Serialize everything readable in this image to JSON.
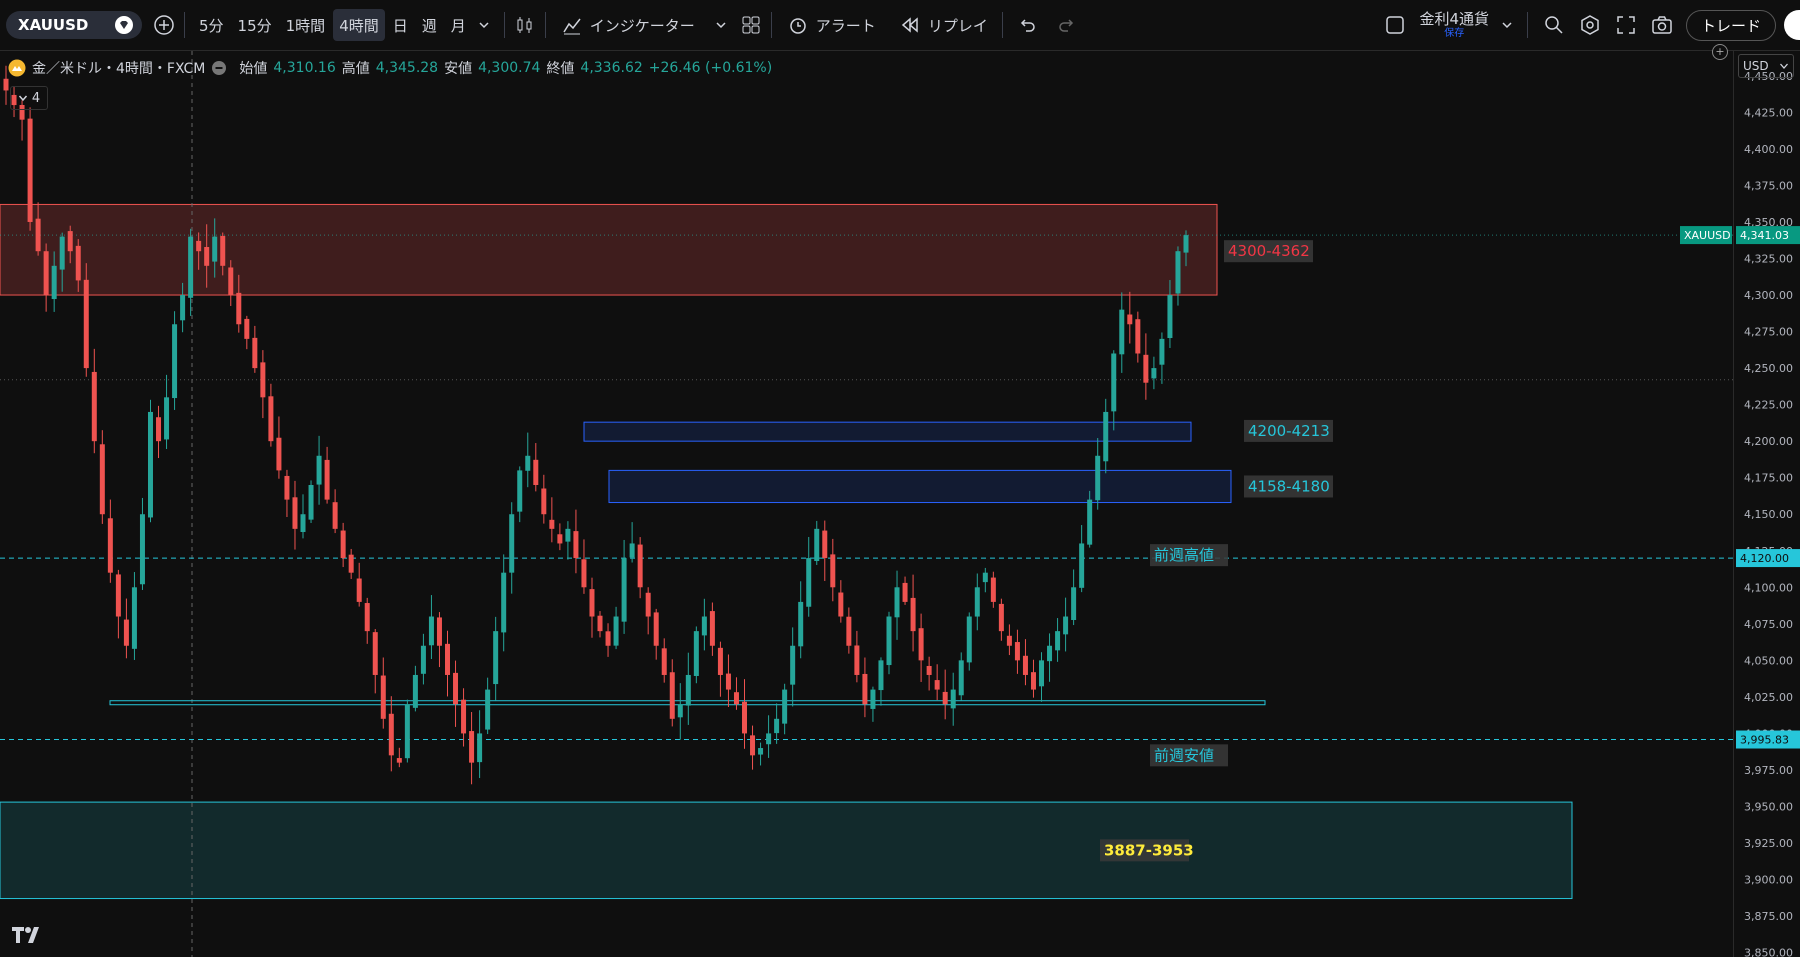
{
  "toolbar": {
    "symbol": "XAUUSD",
    "intervals": [
      "5分",
      "15分",
      "1時間",
      "4時間",
      "日",
      "週",
      "月"
    ],
    "active_interval": "4時間",
    "indicators_label": "インジケーター",
    "alert_label": "アラート",
    "replay_label": "リプレイ",
    "layout_name": "金利4通貨",
    "layout_status": "保存",
    "trade_label": "トレード"
  },
  "legend": {
    "title": "金／米ドル・4時間・FXCM",
    "open_label": "始値",
    "open": "4,310.16",
    "high_label": "高値",
    "high": "4,345.28",
    "low_label": "安値",
    "low": "4,300.74",
    "close_label": "終値",
    "close": "4,336.62",
    "change": "+26.46 (+0.61%)",
    "collapse_count": "4"
  },
  "axis": {
    "currency": "USD",
    "ticks": [
      "4,450.00",
      "4,425.00",
      "4,400.00",
      "4,375.00",
      "4,350.00",
      "4,325.00",
      "4,300.00",
      "4,275.00",
      "4,250.00",
      "4,225.00",
      "4,200.00",
      "4,175.00",
      "4,150.00",
      "4,125.00",
      "4,100.00",
      "4,075.00",
      "4,050.00",
      "4,025.00",
      "4,000.00",
      "3,975.00",
      "3,950.00",
      "3,925.00",
      "3,900.00",
      "3,875.00",
      "3,850.00"
    ],
    "current_symbol": "XAUUSD",
    "current_price": "4,341.03",
    "prev_high_price": "4,120.00",
    "prev_low_price": "3,995.83"
  },
  "zones": [
    {
      "label": "4300-4362",
      "low": 4300,
      "high": 4362,
      "color": "#ef5350"
    },
    {
      "label": "4200-4213",
      "low": 4200,
      "high": 4213,
      "color": "#2962ff"
    },
    {
      "label": "4158-4180",
      "low": 4158,
      "high": 4180,
      "color": "#2962ff"
    },
    {
      "label": "3887-3953",
      "low": 3887,
      "high": 3953,
      "color": "#26c6da"
    }
  ],
  "levels": {
    "prev_week_high_label": "前週高値",
    "prev_week_low_label": "前週安値",
    "prev_week_high": 4120,
    "prev_week_low": 3995.83,
    "support_line": 4021
  },
  "colors": {
    "up": "#26a69a",
    "down": "#ef5350",
    "current": "#089981",
    "level": "#26c6da"
  },
  "chart_data": {
    "type": "candlestick",
    "ylim": [
      3847,
      4467
    ],
    "close_path": [
      4440,
      4430,
      4420,
      4350,
      4330,
      4300,
      4320,
      4340,
      4330,
      4310,
      4250,
      4200,
      4150,
      4110,
      4080,
      4060,
      4100,
      4150,
      4220,
      4200,
      4230,
      4280,
      4300,
      4340,
      4330,
      4320,
      4340,
      4320,
      4300,
      4280,
      4270,
      4250,
      4230,
      4200,
      4180,
      4160,
      4140,
      4150,
      4170,
      4190,
      4160,
      4140,
      4120,
      4110,
      4090,
      4070,
      4040,
      4010,
      3985,
      3980,
      4020,
      4040,
      4060,
      4080,
      4060,
      4040,
      4020,
      4000,
      3980,
      4000,
      4030,
      4070,
      4110,
      4150,
      4180,
      4190,
      4170,
      4150,
      4140,
      4130,
      4140,
      4120,
      4100,
      4080,
      4070,
      4060,
      4080,
      4120,
      4130,
      4100,
      4080,
      4060,
      4040,
      4010,
      4020,
      4040,
      4070,
      4080,
      4060,
      4040,
      4030,
      4020,
      4000,
      3985,
      3990,
      4000,
      4010,
      4030,
      4060,
      4090,
      4120,
      4140,
      4120,
      4100,
      4080,
      4060,
      4040,
      4020,
      4030,
      4050,
      4080,
      4100,
      4090,
      4070,
      4050,
      4040,
      4030,
      4020,
      4030,
      4050,
      4080,
      4100,
      4110,
      4090,
      4070,
      4060,
      4050,
      4040,
      4030,
      4050,
      4060,
      4070,
      4080,
      4100,
      4130,
      4160,
      4190,
      4220,
      4260,
      4290,
      4280,
      4260,
      4240,
      4250,
      4270,
      4300,
      4330,
      4341
    ]
  }
}
